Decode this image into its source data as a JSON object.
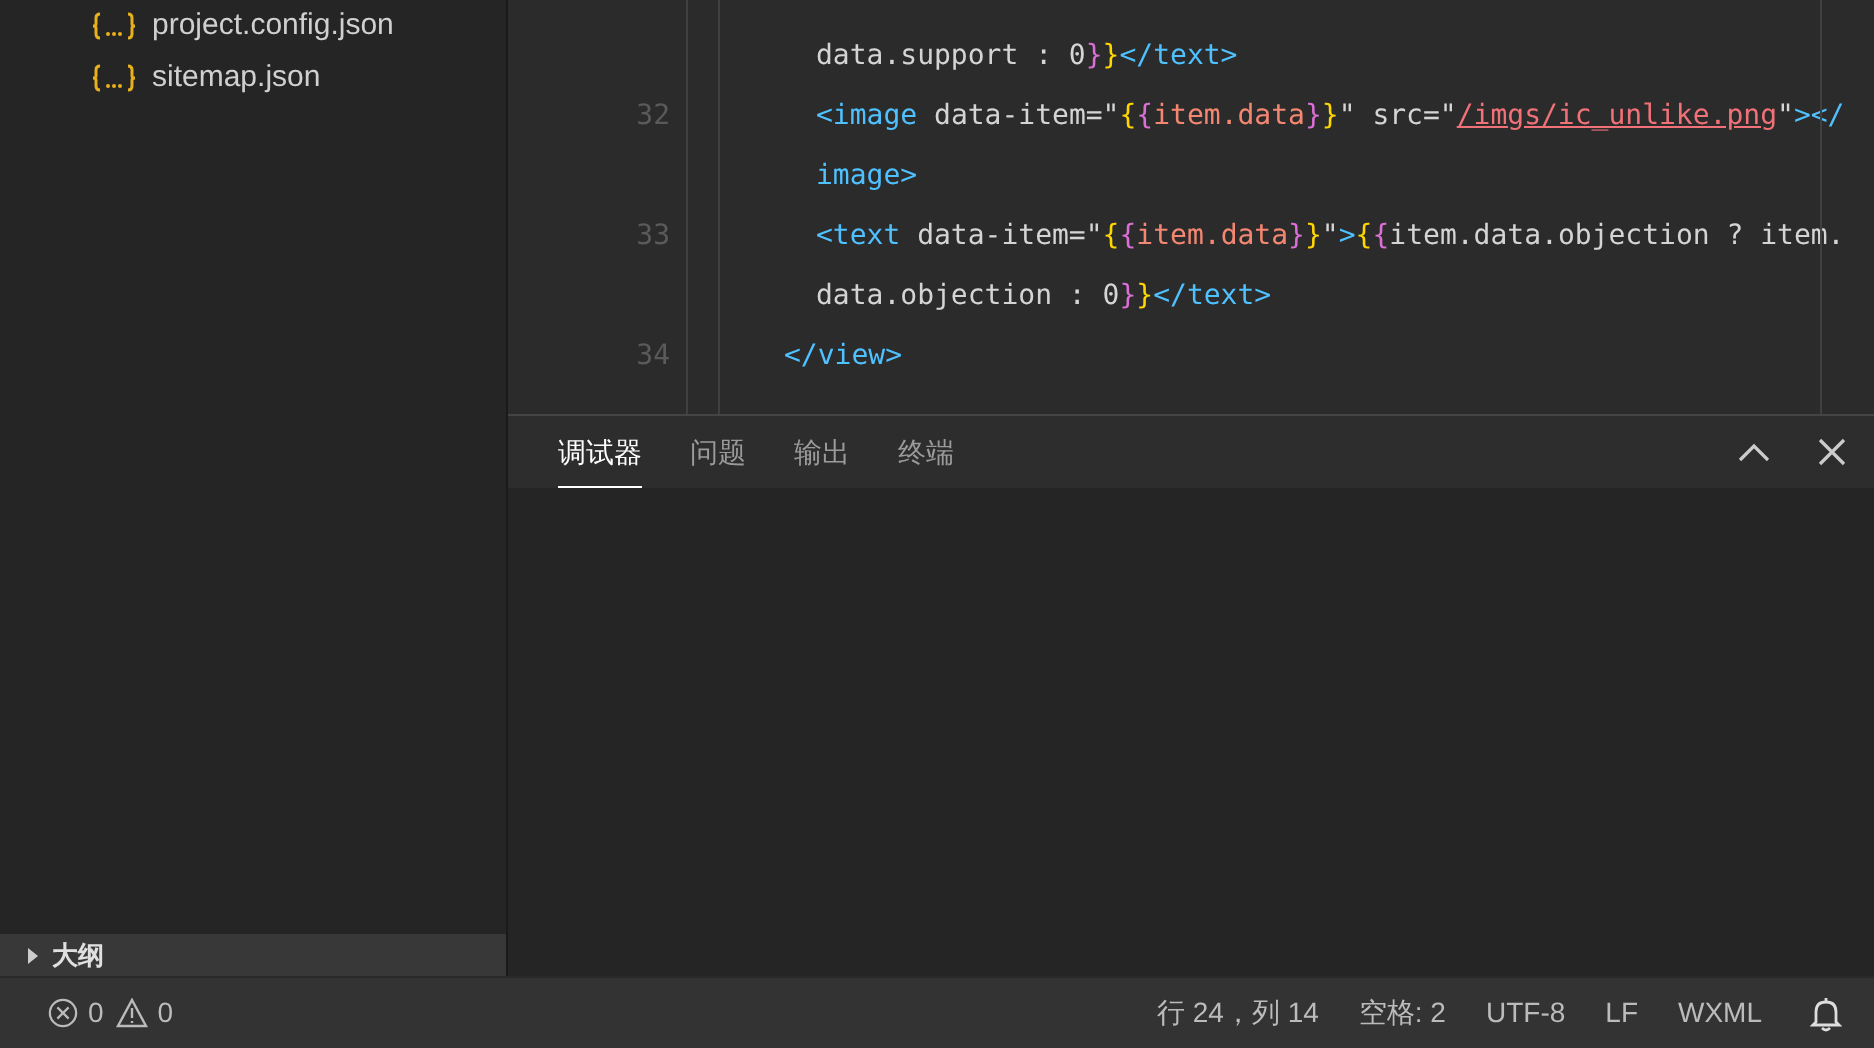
{
  "explorer": {
    "files": [
      {
        "name": "project.config.json"
      },
      {
        "name": "sitemap.json"
      }
    ],
    "outline": {
      "label": "大纲",
      "expanded": false
    }
  },
  "editor": {
    "lines": [
      {
        "kind": "inner",
        "tokens": [
          {
            "kind": "plain",
            "text": "data.support : 0"
          },
          {
            "kind": "brace2",
            "text": "}"
          },
          {
            "kind": "brace1",
            "text": "}"
          },
          {
            "kind": "tag",
            "text": "</text>"
          }
        ]
      },
      {
        "number": "32",
        "kind": "inner",
        "tokens": [
          {
            "kind": "tag",
            "text": "<image "
          },
          {
            "kind": "plain",
            "text": "data-item=\""
          },
          {
            "kind": "brace1",
            "text": "{"
          },
          {
            "kind": "brace2",
            "text": "{"
          },
          {
            "kind": "expr",
            "text": "item.data"
          },
          {
            "kind": "brace2",
            "text": "}"
          },
          {
            "kind": "brace1",
            "text": "}"
          },
          {
            "kind": "plain",
            "text": "\" src=\""
          },
          {
            "kind": "link",
            "text": "/imgs/ic_unlike.png"
          },
          {
            "kind": "plain",
            "text": "\""
          },
          {
            "kind": "tag",
            "text": "></"
          }
        ]
      },
      {
        "kind": "inner",
        "tokens": [
          {
            "kind": "tag",
            "text": "image>"
          }
        ]
      },
      {
        "number": "33",
        "kind": "inner",
        "tokens": [
          {
            "kind": "tag",
            "text": "<text "
          },
          {
            "kind": "plain",
            "text": "data-item=\""
          },
          {
            "kind": "brace1",
            "text": "{"
          },
          {
            "kind": "brace2",
            "text": "{"
          },
          {
            "kind": "expr",
            "text": "item.data"
          },
          {
            "kind": "brace2",
            "text": "}"
          },
          {
            "kind": "brace1",
            "text": "}"
          },
          {
            "kind": "plain",
            "text": "\""
          },
          {
            "kind": "tag",
            "text": ">"
          },
          {
            "kind": "brace1",
            "text": "{"
          },
          {
            "kind": "brace2",
            "text": "{"
          },
          {
            "kind": "plain",
            "text": "item.data.objection ? item."
          }
        ]
      },
      {
        "kind": "inner",
        "tokens": [
          {
            "kind": "plain",
            "text": "data.objection : 0"
          },
          {
            "kind": "brace2",
            "text": "}"
          },
          {
            "kind": "brace1",
            "text": "}"
          },
          {
            "kind": "tag",
            "text": "</text>"
          }
        ]
      },
      {
        "number": "34",
        "kind": "outer",
        "tokens": [
          {
            "kind": "tag",
            "text": "</view>"
          }
        ]
      }
    ]
  },
  "panel": {
    "tabs": [
      {
        "label": "调试器",
        "selected": true
      },
      {
        "label": "问题",
        "selected": false
      },
      {
        "label": "输出",
        "selected": false
      },
      {
        "label": "终端",
        "selected": false
      }
    ]
  },
  "status_bar": {
    "errors": "0",
    "warnings": "0",
    "position": "行 24，列 14",
    "spaces": "空格: 2",
    "encoding": "UTF-8",
    "eol": "LF",
    "language": "WXML"
  }
}
